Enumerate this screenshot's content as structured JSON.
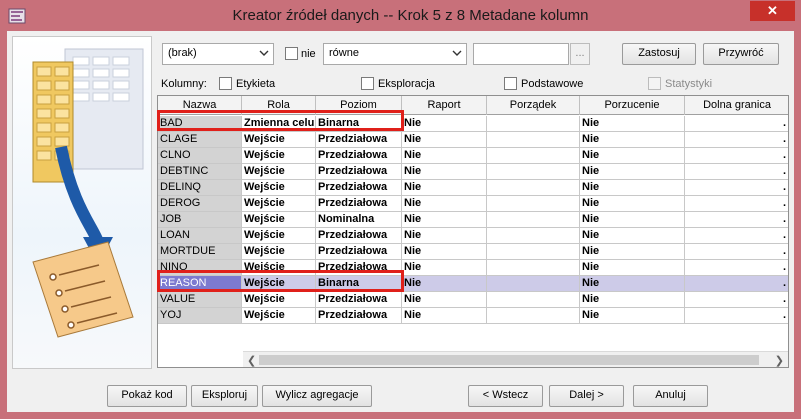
{
  "window": {
    "title": "Kreator źródeł danych  -- Krok 5 z 8  Metadane kolumn",
    "close_label": "✕"
  },
  "filter": {
    "combo_value": "(brak)",
    "nie_label": "nie",
    "condition_value": "równe",
    "text_value": "",
    "browse_label": "...",
    "apply_label": "Zastosuj",
    "reset_label": "Przywróć"
  },
  "columns_bar": {
    "label": "Kolumny:",
    "etykieta": "Etykieta",
    "eksploracja": "Eksploracja",
    "podstawowe": "Podstawowe",
    "statystyki": "Statystyki"
  },
  "table": {
    "headers": [
      "Nazwa",
      "Rola",
      "Poziom",
      "Raport",
      "Porządek",
      "Porzucenie",
      "Dolna granica"
    ],
    "rows": [
      {
        "name": "BAD",
        "role": "Zmienna celu",
        "level": "Binarna",
        "report": "Nie",
        "order": "",
        "drop": "Nie",
        "lower": "."
      },
      {
        "name": "CLAGE",
        "role": "Wejście",
        "level": "Przedziałowa",
        "report": "Nie",
        "order": "",
        "drop": "Nie",
        "lower": "."
      },
      {
        "name": "CLNO",
        "role": "Wejście",
        "level": "Przedziałowa",
        "report": "Nie",
        "order": "",
        "drop": "Nie",
        "lower": "."
      },
      {
        "name": "DEBTINC",
        "role": "Wejście",
        "level": "Przedziałowa",
        "report": "Nie",
        "order": "",
        "drop": "Nie",
        "lower": "."
      },
      {
        "name": "DELINQ",
        "role": "Wejście",
        "level": "Przedziałowa",
        "report": "Nie",
        "order": "",
        "drop": "Nie",
        "lower": "."
      },
      {
        "name": "DEROG",
        "role": "Wejście",
        "level": "Przedziałowa",
        "report": "Nie",
        "order": "",
        "drop": "Nie",
        "lower": "."
      },
      {
        "name": "JOB",
        "role": "Wejście",
        "level": "Nominalna",
        "report": "Nie",
        "order": "",
        "drop": "Nie",
        "lower": "."
      },
      {
        "name": "LOAN",
        "role": "Wejście",
        "level": "Przedziałowa",
        "report": "Nie",
        "order": "",
        "drop": "Nie",
        "lower": "."
      },
      {
        "name": "MORTDUE",
        "role": "Wejście",
        "level": "Przedziałowa",
        "report": "Nie",
        "order": "",
        "drop": "Nie",
        "lower": "."
      },
      {
        "name": "NINQ",
        "role": "Wejście",
        "level": "Przedziałowa",
        "report": "Nie",
        "order": "",
        "drop": "Nie",
        "lower": "."
      },
      {
        "name": "REASON",
        "role": "Wejście",
        "level": "Binarna",
        "report": "Nie",
        "order": "",
        "drop": "Nie",
        "lower": "."
      },
      {
        "name": "VALUE",
        "role": "Wejście",
        "level": "Przedziałowa",
        "report": "Nie",
        "order": "",
        "drop": "Nie",
        "lower": "."
      },
      {
        "name": "YOJ",
        "role": "Wejście",
        "level": "Przedziałowa",
        "report": "Nie",
        "order": "",
        "drop": "Nie",
        "lower": "."
      }
    ],
    "selected_row": "REASON"
  },
  "buttons": {
    "show_code": "Pokaż kod",
    "explore": "Eksploruj",
    "compute": "Wylicz agregacje",
    "back": "< Wstecz",
    "next": "Dalej >",
    "cancel": "Anuluj"
  },
  "colors": {
    "title_bar": "#c8707a",
    "selected_row": "#cdcbe8",
    "selected_name": "#7d7ad0",
    "highlight_box": "#e0201a"
  }
}
